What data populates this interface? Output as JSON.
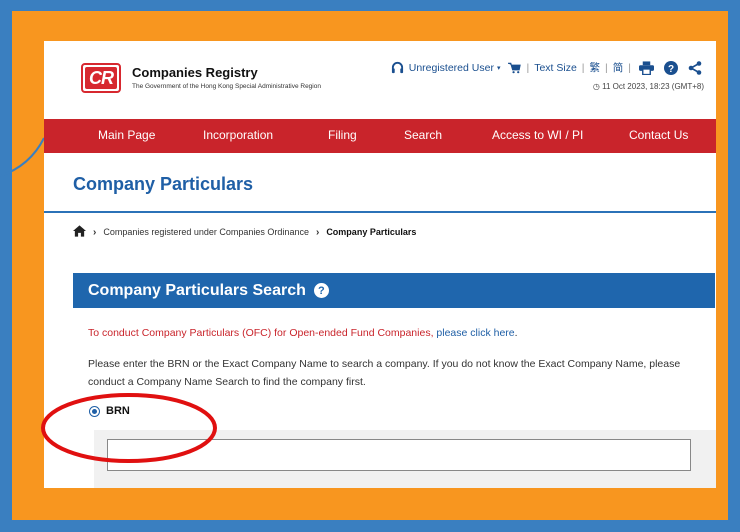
{
  "header": {
    "logo_text": "CR",
    "site_title": "Companies Registry",
    "site_subtitle": "The Government of the Hong Kong Special Administrative Region",
    "user_label": "Unregistered User",
    "text_size_label": "Text Size",
    "lang_traditional": "繁",
    "lang_simplified": "简",
    "timestamp": "11 Oct 2023, 18:23 (GMT+8)"
  },
  "nav": {
    "items": [
      "Main Page",
      "Incorporation",
      "Filing",
      "Search",
      "Access to WI / PI",
      "Contact Us"
    ]
  },
  "page": {
    "title": "Company Particulars",
    "breadcrumb": {
      "parent": "Companies registered under Companies Ordinance",
      "current": "Company Particulars"
    }
  },
  "section": {
    "title": "Company Particulars Search",
    "ofc_text": "To conduct Company Particulars (OFC) for Open-ended Fund Companies,",
    "ofc_link": "please click here",
    "ofc_tail": ".",
    "instructions": "Please enter the BRN or the Exact Company Name to search a company. If you do not know the Exact Company Name, please conduct a Company Name Search to find the company first.",
    "radio_label": "BRN",
    "brn_value": ""
  },
  "colors": {
    "frame_blue": "#3a7fc0",
    "frame_orange": "#f8961f",
    "nav_red": "#c9242b",
    "brand_blue": "#1f66ad",
    "highlight_red": "#e01010"
  },
  "icons": {
    "user": "headphones-icon",
    "cart": "cart-icon",
    "print": "printer-icon",
    "help": "question-icon",
    "share": "share-icon",
    "home": "home-icon",
    "clock": "clock-icon"
  }
}
